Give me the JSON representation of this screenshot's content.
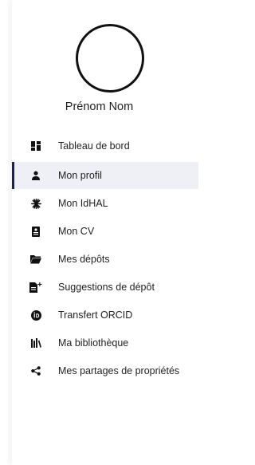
{
  "user": {
    "name": "Prénom Nom"
  },
  "menu": [
    {
      "label": "Tableau de bord",
      "icon": "dashboard-icon"
    },
    {
      "label": "Mon profil",
      "icon": "person-icon",
      "active": true
    },
    {
      "label": "Mon IdHAL",
      "icon": "idhal-icon"
    },
    {
      "label": "Mon CV",
      "icon": "cv-icon"
    },
    {
      "label": "Mes dépôts",
      "icon": "folder-icon"
    },
    {
      "label": "Suggestions de dépôt",
      "icon": "add-document-icon"
    },
    {
      "label": "Transfert ORCID",
      "icon": "orcid-icon"
    },
    {
      "label": "Ma bibliothèque",
      "icon": "library-icon"
    },
    {
      "label": "Mes partages de propriétés",
      "icon": "share-icon"
    }
  ],
  "colors": {
    "active_bar": "#1a1f5e",
    "active_bg": "#eef0f6",
    "icon": "#111111"
  }
}
